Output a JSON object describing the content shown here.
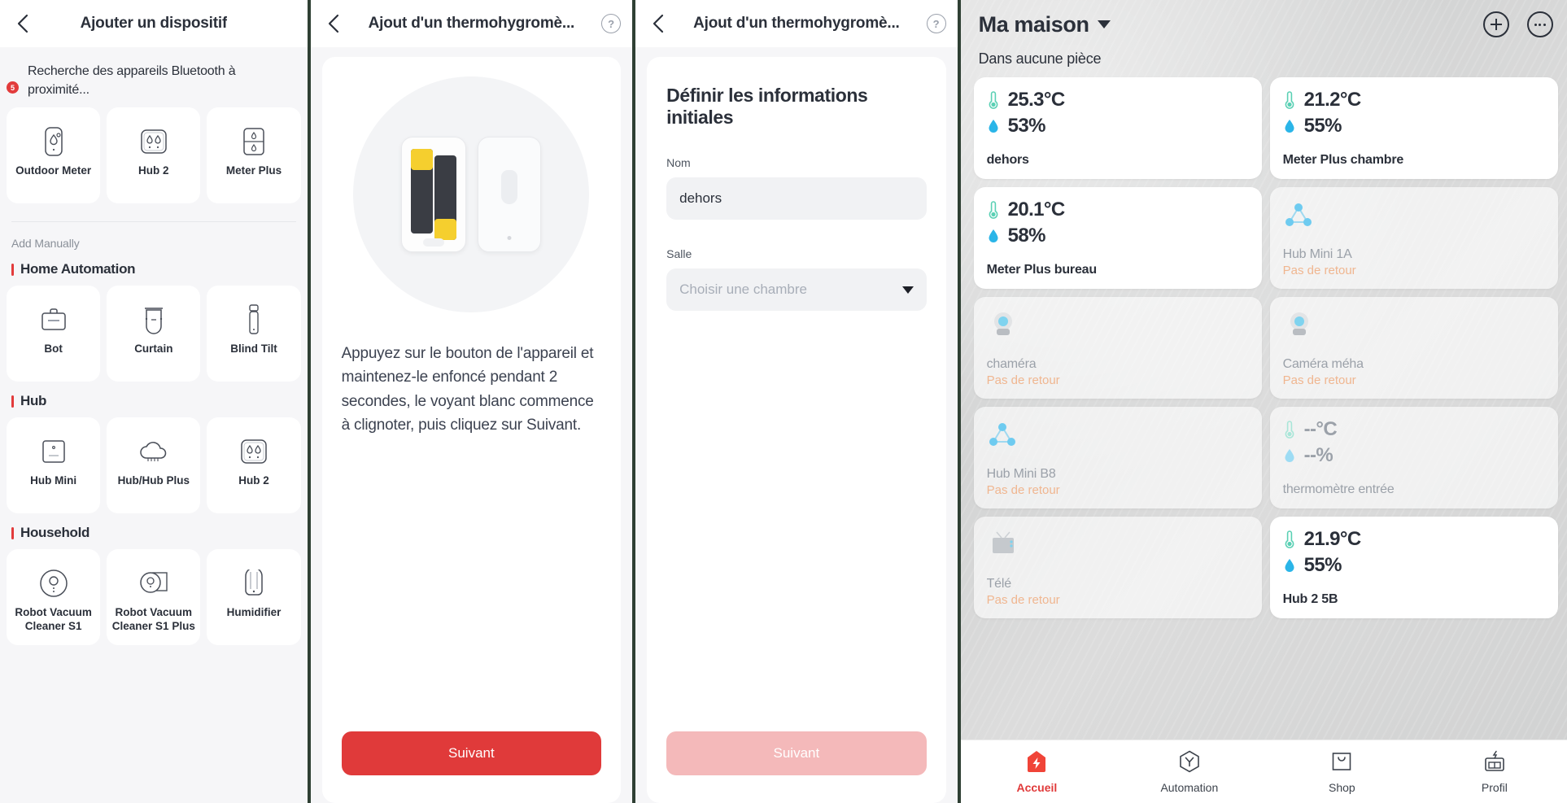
{
  "panel1": {
    "nav": {
      "title": "Ajouter un dispositif",
      "back_icon": "chevron-left-icon"
    },
    "scan": {
      "badge": "5",
      "text": "Recherche des appareils Bluetooth à proximité..."
    },
    "discovered": [
      {
        "label": "Outdoor Meter",
        "icon": "outdoor-meter-icon"
      },
      {
        "label": "Hub 2",
        "icon": "hub2-icon"
      },
      {
        "label": "Meter Plus",
        "icon": "meter-plus-icon"
      }
    ],
    "add_manually_label": "Add Manually",
    "categories": [
      {
        "title": "Home Automation",
        "items": [
          {
            "label": "Bot",
            "icon": "bot-icon"
          },
          {
            "label": "Curtain",
            "icon": "curtain-icon"
          },
          {
            "label": "Blind Tilt",
            "icon": "blind-tilt-icon"
          }
        ]
      },
      {
        "title": "Hub",
        "items": [
          {
            "label": "Hub Mini",
            "icon": "hub-mini-icon"
          },
          {
            "label": "Hub/Hub Plus",
            "icon": "hub-plus-icon"
          },
          {
            "label": "Hub 2",
            "icon": "hub2-icon"
          }
        ]
      },
      {
        "title": "Household",
        "items": [
          {
            "label": "Robot Vacuum Cleaner S1",
            "icon": "robot-vacuum-icon"
          },
          {
            "label": "Robot Vacuum Cleaner S1 Plus",
            "icon": "robot-vacuum-plus-icon"
          },
          {
            "label": "Humidifier",
            "icon": "humidifier-icon"
          }
        ]
      }
    ]
  },
  "panel2": {
    "nav": {
      "title": "Ajout d'un thermohygromè...",
      "back_icon": "chevron-left-icon",
      "help_icon": "help-circle-icon",
      "help_label": "?"
    },
    "instruction": "Appuyez sur le bouton de l'appareil et maintenez-le enfoncé pendant 2 secondes, le voyant blanc commence à clignoter, puis cliquez sur Suivant.",
    "next_label": "Suivant"
  },
  "panel3": {
    "nav": {
      "title": "Ajout d'un thermohygromè...",
      "back_icon": "chevron-left-icon",
      "help_icon": "help-circle-icon",
      "help_label": "?"
    },
    "form_title": "Définir les informations initiales",
    "name_label": "Nom",
    "name_value": "dehors",
    "room_label": "Salle",
    "room_placeholder": "Choisir une chambre",
    "room_value": "",
    "next_label": "Suivant",
    "next_disabled": true
  },
  "panel4": {
    "home_title": "Ma maison",
    "add_icon": "plus-circle-icon",
    "more_icon": "more-circle-icon",
    "room_label": "Dans aucune pièce",
    "devices": [
      {
        "name": "dehors",
        "temp": "25.3°C",
        "hum": "53%",
        "type": "sensor",
        "offline": false
      },
      {
        "name": "Meter Plus chambre",
        "temp": "21.2°C",
        "hum": "55%",
        "type": "sensor",
        "offline": false
      },
      {
        "name": "Meter Plus bureau",
        "temp": "20.1°C",
        "hum": "58%",
        "type": "sensor",
        "offline": false
      },
      {
        "name": "Hub Mini 1A",
        "status": "Pas de retour",
        "type": "hub",
        "offline": true
      },
      {
        "name": "chaméra",
        "status": "Pas de retour",
        "type": "camera",
        "offline": true
      },
      {
        "name": "Caméra méha",
        "status": "Pas de retour",
        "type": "camera",
        "offline": true
      },
      {
        "name": "Hub Mini B8",
        "status": "Pas de retour",
        "type": "hub",
        "offline": true
      },
      {
        "name": "thermomètre entrée",
        "temp": "--°C",
        "hum": "--%",
        "type": "sensor",
        "offline": true
      },
      {
        "name": "Télé",
        "status": "Pas de retour",
        "type": "tv",
        "offline": true
      },
      {
        "name": "Hub 2 5B",
        "temp": "21.9°C",
        "hum": "55%",
        "type": "sensor",
        "offline": false
      }
    ],
    "tabs": [
      {
        "label": "Accueil",
        "icon": "home-bolt-icon",
        "active": true
      },
      {
        "label": "Automation",
        "icon": "hexagon-y-icon",
        "active": false
      },
      {
        "label": "Shop",
        "icon": "bag-icon",
        "active": false
      },
      {
        "label": "Profil",
        "icon": "profile-icon",
        "active": false
      }
    ]
  },
  "colors": {
    "accent": "#e03a3a",
    "accent_disabled": "#f4b9ba",
    "temp": "#5ad0b4",
    "hum": "#2ab5e8",
    "warn": "#f0b690"
  }
}
